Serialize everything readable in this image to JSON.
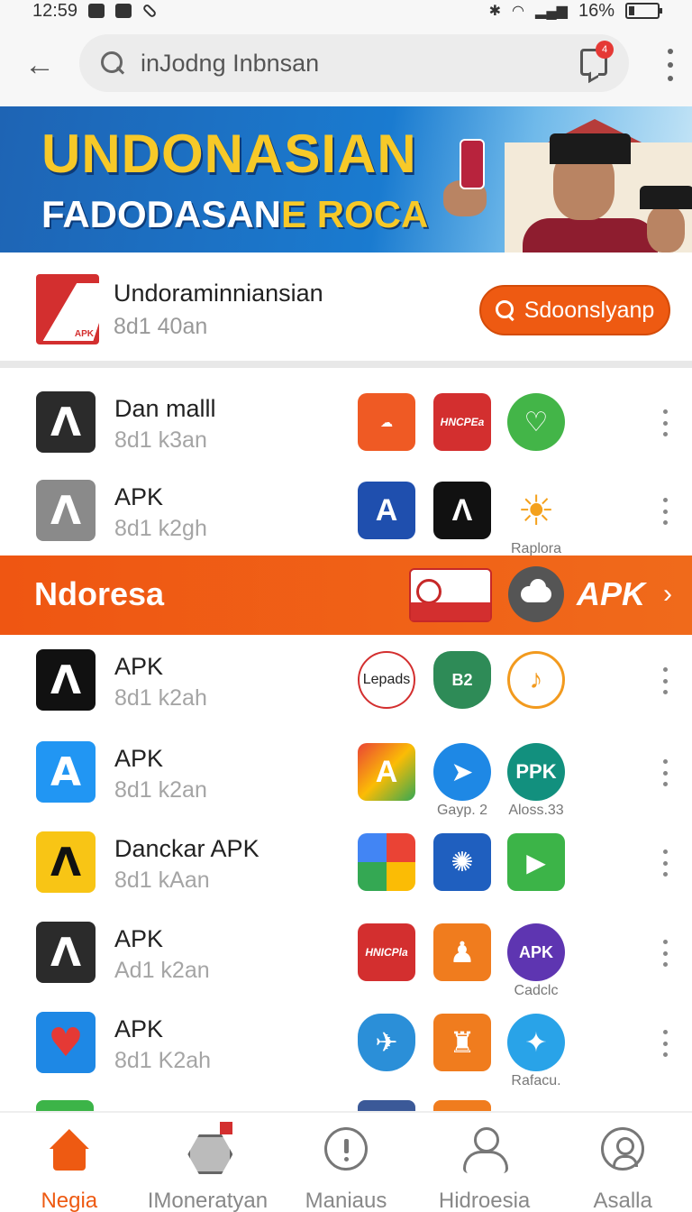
{
  "status_bar": {
    "time": "12:59",
    "battery": "16%"
  },
  "search": {
    "query": "inJodng Inbnsan",
    "notif_count": "4"
  },
  "banner": {
    "title": "UNDONASIAN",
    "subtitle_a": "FADODASAN",
    "subtitle_b": "E ROCA"
  },
  "featured": {
    "icon_text": "APK",
    "title": "Undoraminniansian",
    "meta": "8d1 40an",
    "button_label": "Sdoonslyanp"
  },
  "rows_top": [
    {
      "name": "Dan malll",
      "meta": "8d1 k3an",
      "m1": "",
      "m2": "HNCPEa",
      "m3": "",
      "m3_caption": ""
    },
    {
      "name": "APK",
      "meta": "8d1 k2gh",
      "m1": "",
      "m2": "",
      "m3": "",
      "m3_caption": "Raplora"
    }
  ],
  "section": {
    "title": "Ndoresa",
    "apk_label": "APK",
    "chevron": "›"
  },
  "rows_bottom": [
    {
      "name": "APK",
      "meta": "8d1 k2ah",
      "m1": "Lepads",
      "m2": "B2",
      "m3": "",
      "m2_caption": "",
      "m3_caption": ""
    },
    {
      "name": "APK",
      "meta": "8d1 k2an",
      "m1": "",
      "m2": "",
      "m3": "PPK",
      "m2_caption": "Gayp. 2",
      "m3_caption": "Aloss.33"
    },
    {
      "name": "Danckar APK",
      "meta": "8d1 kAan",
      "m1": "",
      "m2": "",
      "m3": "",
      "m2_caption": "",
      "m3_caption": ""
    },
    {
      "name": "APK",
      "meta": "Ad1 k2an",
      "m1": "HNICPla",
      "m2": "",
      "m3": "APK",
      "m2_caption": "",
      "m3_caption": "Cadclc"
    },
    {
      "name": "APK",
      "meta": "8d1 K2ah",
      "m1": "",
      "m2": "",
      "m3": "",
      "m2_caption": "",
      "m3_caption": "Rafacu."
    }
  ],
  "nav": [
    {
      "label": "Negia"
    },
    {
      "label": "IMoneratyan"
    },
    {
      "label": "Maniaus"
    },
    {
      "label": "Hidroesia"
    },
    {
      "label": "Asalla"
    }
  ]
}
